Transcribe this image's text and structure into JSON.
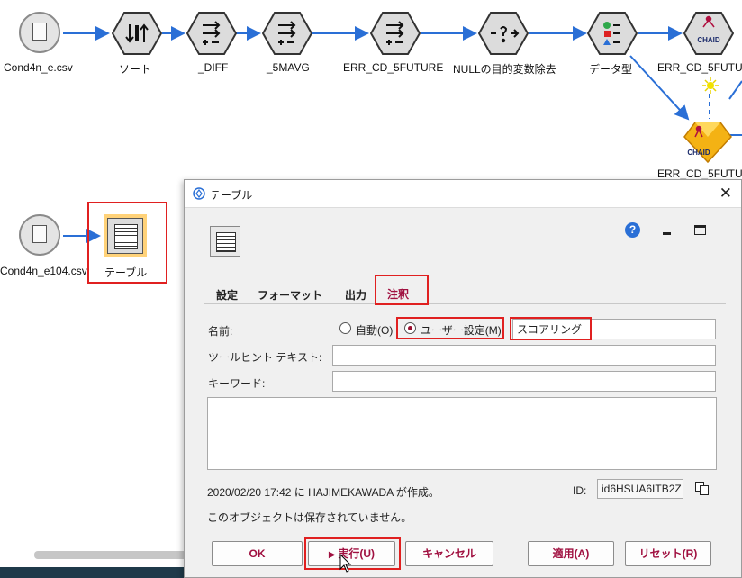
{
  "stream": {
    "nodes": [
      {
        "label": "Cond4n_e.csv"
      },
      {
        "label": "ソート"
      },
      {
        "label": "_DIFF"
      },
      {
        "label": "_5MAVG"
      },
      {
        "label": "ERR_CD_5FUTURE"
      },
      {
        "label": "NULLの目的変数除去"
      },
      {
        "label": "データ型"
      },
      {
        "label": "ERR_CD_5FUTU"
      },
      {
        "label": "ERR_CD_5FUTU"
      },
      {
        "label": "Cond4n_e104.csv"
      },
      {
        "label": "テーブル"
      }
    ],
    "chaid_badge": "CHAID",
    "chaid_badge_2": "CHAID"
  },
  "dialog": {
    "title": "テーブル",
    "tabs": [
      "設定",
      "フォーマット",
      "出力",
      "注釈"
    ],
    "active_tab": "注釈",
    "name_label": "名前:",
    "radio_auto": "自動(O)",
    "radio_custom": "ユーザー設定(M)",
    "name_value": "スコアリング",
    "tooltip_label": "ツールヒント テキスト:",
    "tooltip_value": "",
    "keyword_label": "キーワード:",
    "keyword_value": "",
    "annotation_value": "",
    "created_text": "2020/02/20 17:42 に HAJIMEKAWADA が作成。",
    "id_label": "ID:",
    "id_value": "id6HSUA6ITB2Z",
    "not_saved_text": "このオブジェクトは保存されていません。",
    "buttons": {
      "ok": "OK",
      "run": "実行(U)",
      "cancel": "キャンセル",
      "apply": "適用(A)",
      "reset": "リセット(R)"
    }
  },
  "colors": {
    "highlight_red": "#e02020",
    "accent": "#a01040",
    "arrow": "#2a6fd6"
  }
}
